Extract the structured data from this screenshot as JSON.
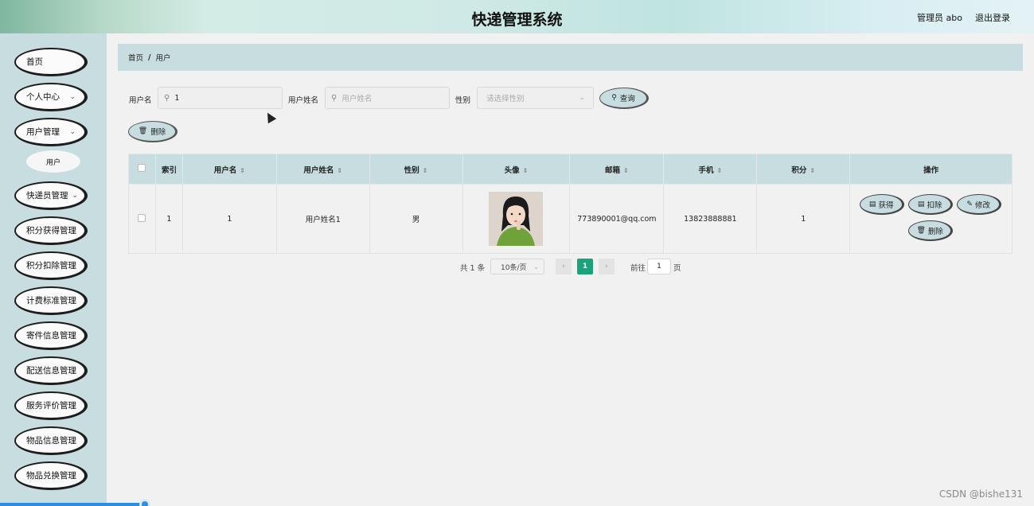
{
  "header": {
    "title": "快递管理系统",
    "admin": "管理员 abo",
    "logout": "退出登录"
  },
  "sidebar": {
    "items": [
      {
        "label": "首页",
        "has_chevron": false
      },
      {
        "label": "个人中心",
        "has_chevron": true
      },
      {
        "label": "用户管理",
        "has_chevron": true
      },
      {
        "label": "快递员管理",
        "has_chevron": true
      },
      {
        "label": "积分获得管理",
        "has_chevron": false
      },
      {
        "label": "积分扣除管理",
        "has_chevron": false
      },
      {
        "label": "计费标准管理",
        "has_chevron": false
      },
      {
        "label": "寄件信息管理",
        "has_chevron": false
      },
      {
        "label": "配送信息管理",
        "has_chevron": false
      },
      {
        "label": "服务评价管理",
        "has_chevron": false
      },
      {
        "label": "物品信息管理",
        "has_chevron": false
      },
      {
        "label": "物品兑换管理",
        "has_chevron": false
      }
    ],
    "sub_item": "用户"
  },
  "breadcrumb": {
    "home": "首页",
    "separator": "/",
    "current": "用户"
  },
  "search": {
    "username_label": "用户名",
    "username_value": "1",
    "realname_label": "用户姓名",
    "realname_placeholder": "用户姓名",
    "gender_label": "性别",
    "gender_placeholder": "请选择性别",
    "query_button": "查询",
    "delete_button": "删除"
  },
  "table": {
    "columns": [
      "索引",
      "用户名",
      "用户姓名",
      "性别",
      "头像",
      "邮箱",
      "手机",
      "积分",
      "操作"
    ],
    "rows": [
      {
        "index": "1",
        "username": "1",
        "realname": "用户姓名1",
        "gender": "男",
        "email": "773890001@qq.com",
        "phone": "13823888881",
        "points": "1"
      }
    ],
    "actions": {
      "gain": "获得",
      "deduct": "扣除",
      "edit": "修改",
      "delete": "删除"
    }
  },
  "pagination": {
    "total": "共 1 条",
    "page_size": "10条/页",
    "prev": "‹",
    "current_page": "1",
    "next": "›",
    "goto_label": "前往",
    "goto_value": "1",
    "page_suffix": "页"
  },
  "watermark": "CSDN @bishe131",
  "colors": {
    "panel": "#c8dde0",
    "accent": "#1aa37a",
    "background": "#f1f1f1"
  }
}
